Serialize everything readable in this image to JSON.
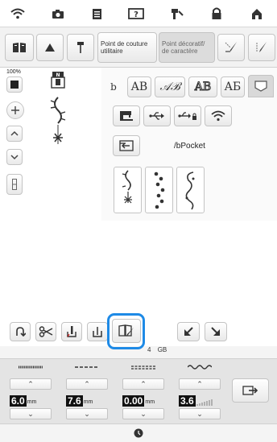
{
  "status_bar": {
    "icons": [
      "wifi-icon",
      "camera-icon",
      "document-icon",
      "help-icon",
      "thread-icon",
      "lock-icon",
      "home-icon"
    ]
  },
  "tabs": {
    "utility_label": "Point de couture utilitaire",
    "decorative_label": "Point décoratif/ de caractère"
  },
  "left_tools": {
    "zoom_label": "100%"
  },
  "fonts": {
    "items": [
      "AB",
      "𝒜ℬ",
      "AB",
      "AБ"
    ]
  },
  "pocket": {
    "label": "/bPocket"
  },
  "footer_tools": {
    "storage_text": "4",
    "storage_unit": "GB"
  },
  "settings": {
    "width": {
      "value": "6.0",
      "unit": "mm"
    },
    "length": {
      "value": "7.6",
      "unit": "mm"
    },
    "offset": {
      "value": "0.00",
      "unit": "mm"
    },
    "tension": {
      "value": "3.6"
    }
  },
  "colors": {
    "highlight": "#1e8ae6"
  }
}
